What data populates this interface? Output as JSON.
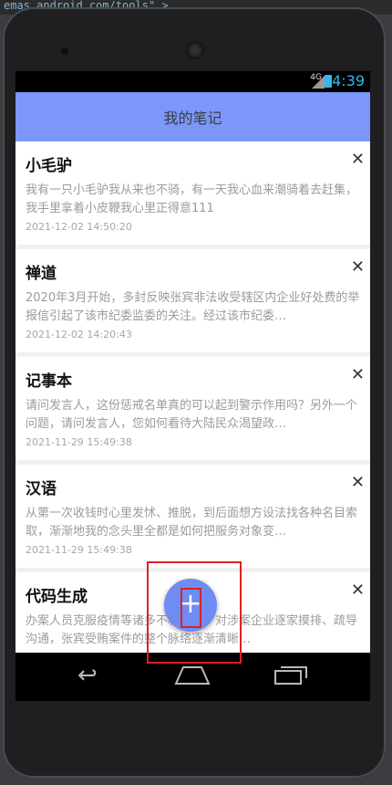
{
  "ide_strip": {
    "text": "emas.android.com/tools\" >"
  },
  "status_bar": {
    "network": "4G",
    "time": "4:39"
  },
  "app_bar": {
    "title": "我的笔记"
  },
  "notes": [
    {
      "title": "小毛驴",
      "content": "我有一只小毛驴我从来也不骑，有一天我心血来潮骑着去赶集，我手里拿着小皮鞭我心里正得意111",
      "date": "2021-12-02 14:50:20"
    },
    {
      "title": "禅道",
      "content": "2020年3月开始，多封反映张宾非法收受辖区内企业好处费的举报信引起了该市纪委监委的关注。经过该市纪委…",
      "date": "2021-12-02 14:20:43"
    },
    {
      "title": "记事本",
      "content": "请问发言人，这份惩戒名单真的可以起到警示作用吗？另外一个问题，请问发言人，您如何看待大陆民众渴望政…",
      "date": "2021-11-29 15:49:38"
    },
    {
      "title": "汉语",
      "content": "从第一次收钱时心里发怵、推脱，到后面想方设法找各种名目索取，渐渐地我的念头里全都是如何把服务对象变…",
      "date": "2021-11-29 15:49:38"
    },
    {
      "title": "代码生成",
      "content": "办案人员克服疫情等诸多不利影响，对涉案企业逐家摸排、疏导沟通，张宾受贿案件的整个脉络逐渐清晰…",
      "date": ""
    }
  ],
  "icons": {
    "close": "close-icon",
    "add": "plus-icon",
    "back": "back-icon",
    "home": "home-icon",
    "recents": "recents-icon"
  },
  "fab": {
    "label": "+"
  },
  "colors": {
    "app_bar": "#7b97fb",
    "fab": "#6e8cf2",
    "highlight": "#e02020",
    "status_time": "#35b6ec"
  }
}
